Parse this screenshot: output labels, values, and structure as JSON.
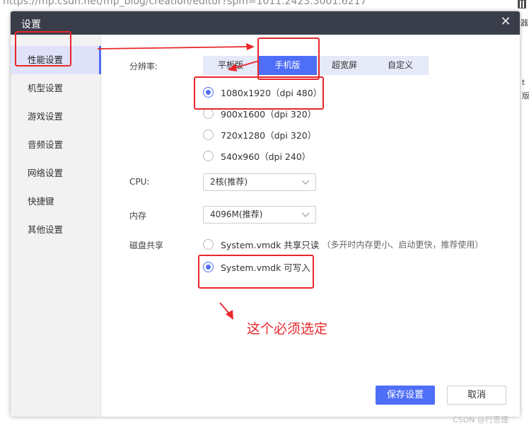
{
  "background": {
    "url_text": "https://mp.csdn.net/mp_blog/creation/editor?spm=1011.2423.3001.6217",
    "right_text_1": "器",
    "right_text_2": "t",
    "right_text_3": "版"
  },
  "dialog": {
    "title": "设置",
    "close_icon": "close-icon"
  },
  "sidebar": {
    "items": [
      {
        "label": "性能设置",
        "active": true
      },
      {
        "label": "机型设置",
        "active": false
      },
      {
        "label": "游戏设置",
        "active": false
      },
      {
        "label": "音频设置",
        "active": false
      },
      {
        "label": "网络设置",
        "active": false
      },
      {
        "label": "快捷键",
        "active": false
      },
      {
        "label": "其他设置",
        "active": false
      }
    ]
  },
  "resolution": {
    "label": "分辨率:",
    "tabs": [
      "平板版",
      "手机版",
      "超宽屏",
      "自定义"
    ],
    "active_tab": "手机版",
    "options": [
      {
        "text": "1080x1920（dpi 480）",
        "checked": true
      },
      {
        "text": "900x1600（dpi 320）",
        "checked": false
      },
      {
        "text": "720x1280（dpi 320）",
        "checked": false
      },
      {
        "text": "540x960（dpi 240）",
        "checked": false
      }
    ]
  },
  "cpu": {
    "label": "CPU:",
    "value": "2核(推荐)"
  },
  "memory": {
    "label": "内存",
    "value": "4096M(推荐)"
  },
  "disk_share": {
    "label": "磁盘共享",
    "options": [
      {
        "text": "System.vmdk 共享只读",
        "hint": "（多开时内存更小、启动更快，推荐使用）",
        "checked": false
      },
      {
        "text": "System.vmdk 可写入",
        "hint": "",
        "checked": true
      }
    ]
  },
  "footer": {
    "save_label": "保存设置",
    "cancel_label": "取消"
  },
  "annotation": {
    "note": "这个必须选定"
  },
  "watermark": "CSDN @行思理",
  "colors": {
    "accent": "#4f6ef7",
    "titlebar": "#3a3d4a",
    "annotation_red": "#e8262b",
    "sidebar_bg": "#f2f2f3"
  }
}
